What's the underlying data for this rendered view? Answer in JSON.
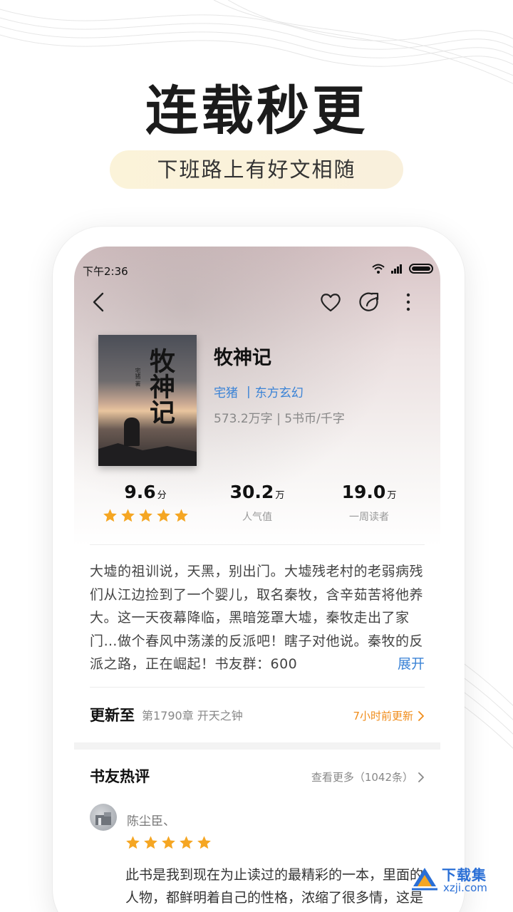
{
  "promo": {
    "headline": "连载秒更",
    "subline": "下班路上有好文相随"
  },
  "status_bar": {
    "time": "下午2:36"
  },
  "book": {
    "title": "牧神记",
    "author": "宅猪",
    "separator": "|",
    "genre": "东方玄幻",
    "info": "573.2万字 | 5书币/千字",
    "cover_title": "牧神记",
    "cover_author": "宅猪 著"
  },
  "stats": {
    "rating": {
      "value": "9.6",
      "unit": "分",
      "stars": 5
    },
    "popularity": {
      "value": "30.2",
      "unit": "万",
      "label": "人气值"
    },
    "weekly_readers": {
      "value": "19.0",
      "unit": "万",
      "label": "一周读者"
    }
  },
  "synopsis": {
    "text": "大墟的祖训说，天黑，别出门。大墟残老村的老弱病残们从江边捡到了一个婴儿，取名秦牧，含辛茹苦将他养大。这一天夜幕降临，黑暗笼罩大墟，秦牧走出了家门…做个春风中荡漾的反派吧！瞎子对他说。秦牧的反派之路，正在崛起！书友群：600",
    "expand_label": "展开"
  },
  "update": {
    "label": "更新至",
    "chapter": "第1790章 开天之钟",
    "time": "7小时前更新"
  },
  "reviews": {
    "title": "书友热评",
    "more": "查看更多（1042条）",
    "items": [
      {
        "user": "陈尘臣、",
        "stars": 5,
        "text": "此书是我到现在为止读过的最精彩的一本，里面的人物，都鲜明着自己的性格，浓缩了很多情，这是国内少有之佳"
      }
    ]
  },
  "watermark": {
    "name": "下载集",
    "domain": "xzji.com"
  },
  "colors": {
    "accent_blue": "#3b83d6",
    "star_orange": "#f5a623",
    "update_orange": "#f08c1a"
  }
}
